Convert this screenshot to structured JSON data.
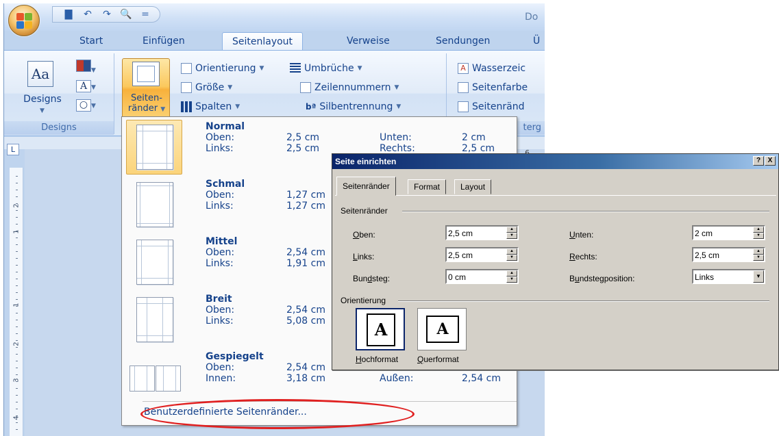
{
  "titlebar": {
    "title": "Do"
  },
  "quick_access": [
    {
      "name": "save-icon",
      "glyph": "▇"
    },
    {
      "name": "undo-icon",
      "glyph": "↶"
    },
    {
      "name": "redo-icon",
      "glyph": "↷"
    },
    {
      "name": "print-preview-icon",
      "glyph": "🔍"
    },
    {
      "name": "customize-icon",
      "glyph": "="
    }
  ],
  "tabs": [
    "Start",
    "Einfügen",
    "Seitenlayout",
    "Verweise",
    "Sendungen",
    "Ü"
  ],
  "active_tab": "Seitenlayout",
  "ribbon": {
    "designs_group": {
      "button": "Designs",
      "label": "Designs"
    },
    "margins_button": {
      "line1": "Seiten-",
      "line2": "ränder"
    },
    "page_setup": {
      "orientation": "Orientierung",
      "size": "Größe",
      "columns": "Spalten",
      "breaks": "Umbrüche",
      "line_numbers": "Zeilennummern",
      "hyphenation": "Silbentrennung"
    },
    "page_background": {
      "watermark": "Wasserzeic",
      "page_color": "Seitenfarbe",
      "page_borders": "Seitenränd",
      "group_label": "terg"
    }
  },
  "ruler": {
    "top_fragment": "6",
    "left_numbers": [
      "2",
      "1",
      "1",
      "2",
      "3",
      "4"
    ]
  },
  "margins_menu": {
    "presets": [
      {
        "name": "Normal",
        "l1": "Oben:",
        "v1": "2,5 cm",
        "l2": "Links:",
        "v2": "2,5 cm",
        "l3": "Unten:",
        "v3": "2 cm",
        "l4": "Rechts:",
        "v4": "2,5 cm"
      },
      {
        "name": "Schmal",
        "l1": "Oben:",
        "v1": "1,27 cm",
        "l2": "Links:",
        "v2": "1,27 cm"
      },
      {
        "name": "Mittel",
        "l1": "Oben:",
        "v1": "2,54 cm",
        "l2": "Links:",
        "v2": "1,91 cm"
      },
      {
        "name": "Breit",
        "l1": "Oben:",
        "v1": "2,54 cm",
        "l2": "Links:",
        "v2": "5,08 cm"
      },
      {
        "name": "Gespiegelt",
        "l1": "Oben:",
        "v1": "2,54 cm",
        "l2": "Innen:",
        "v2": "3,18 cm",
        "l4": "Außen:",
        "v4": "2,54 cm"
      }
    ],
    "selected": "Normal",
    "custom": "Benutzerdefinierte Seitenränder..."
  },
  "dialog": {
    "title": "Seite einrichten",
    "help": "?",
    "close": "X",
    "tabs": [
      "Seitenränder",
      "Format",
      "Layout"
    ],
    "active_tab": "Seitenränder",
    "margins_section": "Seitenränder",
    "fields": {
      "top": {
        "label": "Oben:",
        "value": "2,5 cm"
      },
      "left": {
        "label": "Links:",
        "value": "2,5 cm"
      },
      "gutter": {
        "label": "Bundsteg:",
        "value": "0 cm"
      },
      "bottom": {
        "label": "Unten:",
        "value": "2 cm"
      },
      "right": {
        "label": "Rechts:",
        "value": "2,5 cm"
      },
      "gutter_pos": {
        "label": "Bundstegposition:",
        "value": "Links"
      }
    },
    "orientation_section": "Orientierung",
    "portrait": "Hochformat",
    "landscape": "Querformat",
    "orient_glyph": "A"
  },
  "colors": {
    "ribbon_text": "#15428b",
    "dialog_title": "#0a246a",
    "highlight": "#e02020",
    "selected_preset": "#fbd47b"
  }
}
